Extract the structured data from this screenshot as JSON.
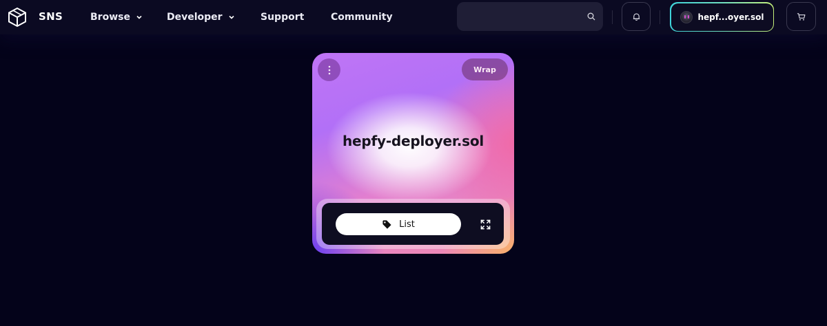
{
  "header": {
    "brand": "SNS",
    "nav": [
      {
        "label": "Browse",
        "has_dropdown": true
      },
      {
        "label": "Developer",
        "has_dropdown": true
      },
      {
        "label": "Support",
        "has_dropdown": false
      },
      {
        "label": "Community",
        "has_dropdown": false
      }
    ],
    "search": {
      "placeholder": "",
      "value": "",
      "icon": "search-icon"
    },
    "notifications_icon": "bell-icon",
    "wallet": {
      "label": "hepf...oyer.sol",
      "avatar": "avatar"
    },
    "cart_icon": "cart-icon"
  },
  "card": {
    "domain": "hepfy-deployer.sol",
    "menu_icon": "more-vertical-icon",
    "wrap_label": "Wrap",
    "list_label": "List",
    "list_icon": "tag-icon",
    "expand_icon": "expand-icon"
  },
  "colors": {
    "background": "#04031a",
    "header": "#0b0a22",
    "wallet_border_start": "#3fd3d9",
    "wallet_border_end": "#c5f07a",
    "card_purple": "#b270f7",
    "card_pink": "#f08cb0",
    "card_orange": "#f8b06a"
  }
}
